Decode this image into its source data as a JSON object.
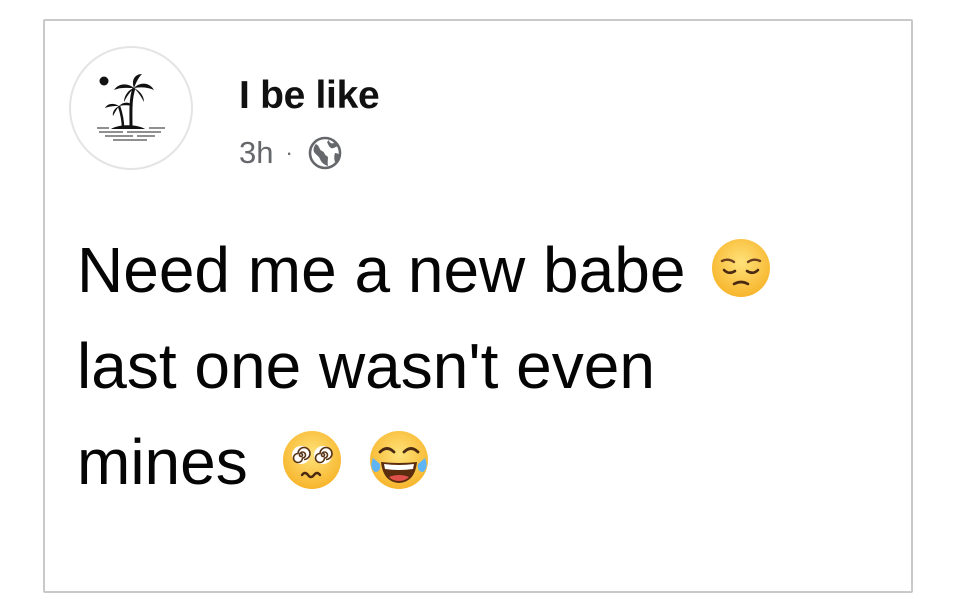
{
  "post": {
    "author": "I be like",
    "timestamp": "3h",
    "separator": "·",
    "audience_icon": "globe-icon",
    "avatar_icon": "palm-tree-island-icon",
    "text_lines": [
      "Need me a new babe",
      "last one wasn't even",
      "mines"
    ],
    "emojis": [
      "pensive-face",
      "dizzy-face",
      "tears-of-joy-face"
    ]
  },
  "colors": {
    "border": "#c9c9c9",
    "text": "#050505",
    "meta_text": "#65676b",
    "emoji_yellow": "#ffc83d"
  }
}
